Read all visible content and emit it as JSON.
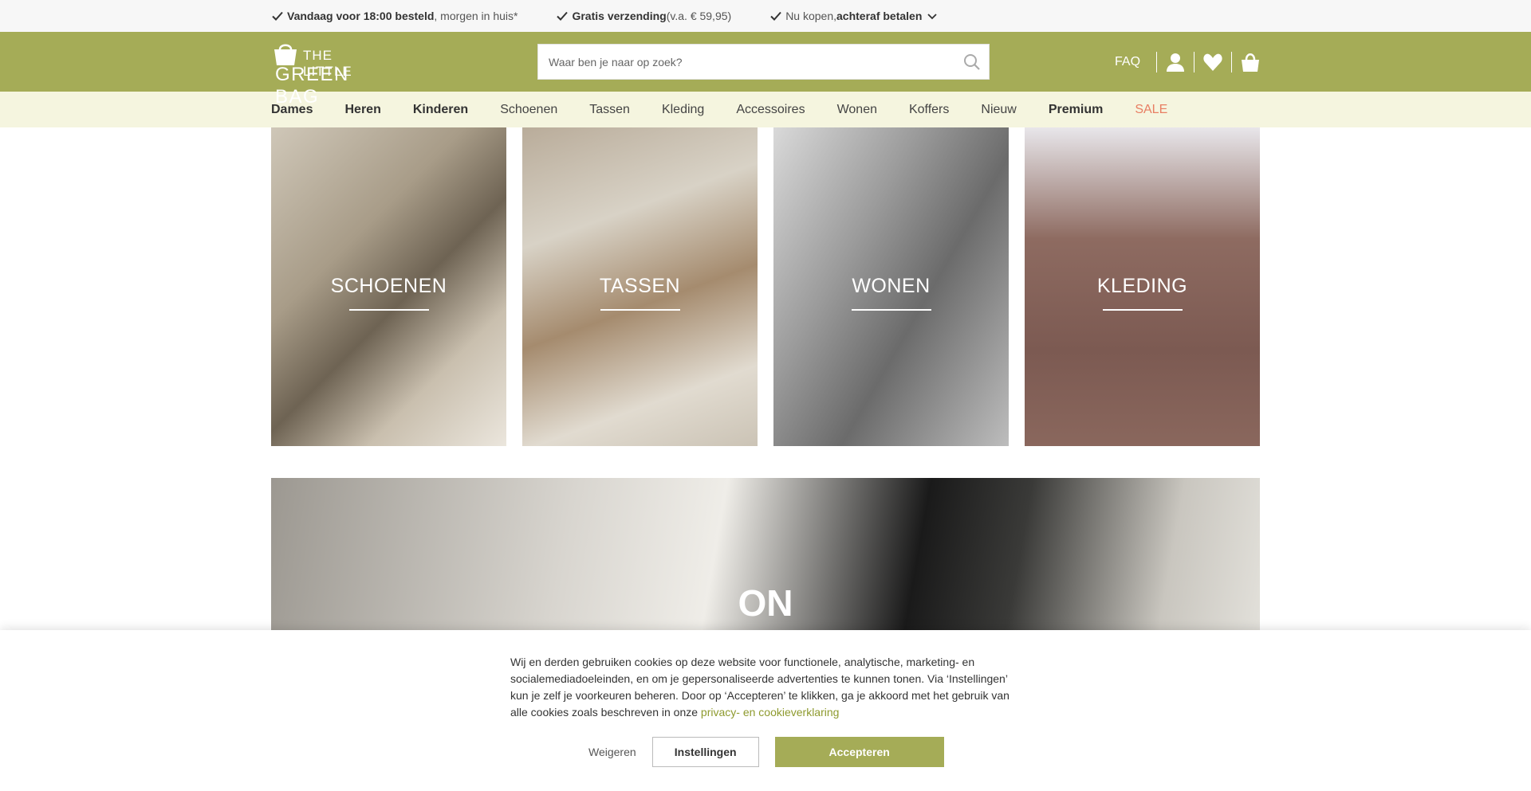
{
  "usp": {
    "item1": {
      "bold": "Vandaag voor 18:00 besteld",
      "rest": ", morgen in huis*"
    },
    "item2": {
      "bold": "Gratis verzending",
      "rest": " (v.a. € 59,95)"
    },
    "item3": {
      "rest": "Nu kopen, ",
      "bold": "achteraf betalen"
    }
  },
  "header": {
    "logo_line1": "THE LITTLE",
    "logo_line2": "GREEN BAG",
    "search_placeholder": "Waar ben je naar op zoek?",
    "faq": "FAQ"
  },
  "nav": {
    "items": [
      {
        "label": "Dames"
      },
      {
        "label": "Heren"
      },
      {
        "label": "Kinderen"
      },
      {
        "label": "Schoenen"
      },
      {
        "label": "Tassen"
      },
      {
        "label": "Kleding"
      },
      {
        "label": "Accessoires"
      },
      {
        "label": "Wonen"
      },
      {
        "label": "Koffers"
      },
      {
        "label": "Nieuw"
      },
      {
        "label": "Premium"
      },
      {
        "label": "SALE"
      }
    ]
  },
  "tiles": [
    {
      "label": "SCHOENEN"
    },
    {
      "label": "TASSEN"
    },
    {
      "label": "WONEN"
    },
    {
      "label": "KLEDING"
    }
  ],
  "banner": {
    "title": "ON"
  },
  "cookie": {
    "text": "Wij en derden gebruiken cookies op deze website voor functionele, analytische, marketing- en socialemediadoeleinden, en om je gepersonaliseerde advertenties te kunnen tonen. Via ‘Instellingen’ kun je zelf je voorkeuren beheren. Door op ‘Accepteren’ te klikken, ga je akkoord met het gebruik van alle cookies zoals beschreven in onze ",
    "link": "privacy- en cookieverklaring",
    "weigeren": "Weigeren",
    "instellingen": "Instellingen",
    "accepteren": "Accepteren"
  },
  "colors": {
    "brand_green": "#a5ac57",
    "nav_bg": "#f5f5df",
    "sale": "#e87e63"
  }
}
